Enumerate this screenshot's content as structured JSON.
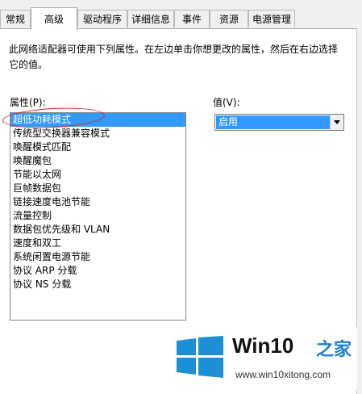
{
  "tabs": [
    "常规",
    "高级",
    "驱动程序",
    "详细信息",
    "事件",
    "资源",
    "电源管理"
  ],
  "active_tab": "高级",
  "description": "此网络适配器可使用下列属性。在左边单击你想更改的属性，然后在右边选择它的值。",
  "property_label": "属性(P):",
  "value_label": "值(V):",
  "properties": [
    "超低功耗模式",
    "传统型交换器兼容模式",
    "唤醒模式匹配",
    "唤醒魔包",
    "节能以太网",
    "巨帧数据包",
    "链接速度电池节能",
    "流量控制",
    "数据包优先级和 VLAN",
    "速度和双工",
    "系统闲置电源节能",
    "协议 ARP 分载",
    "协议 NS 分载"
  ],
  "selected_property": "超低功耗模式",
  "value_selected": "启用",
  "watermark": {
    "brand": "Win10",
    "brand_suffix": "之家",
    "url": "www.win10xitong.com"
  }
}
